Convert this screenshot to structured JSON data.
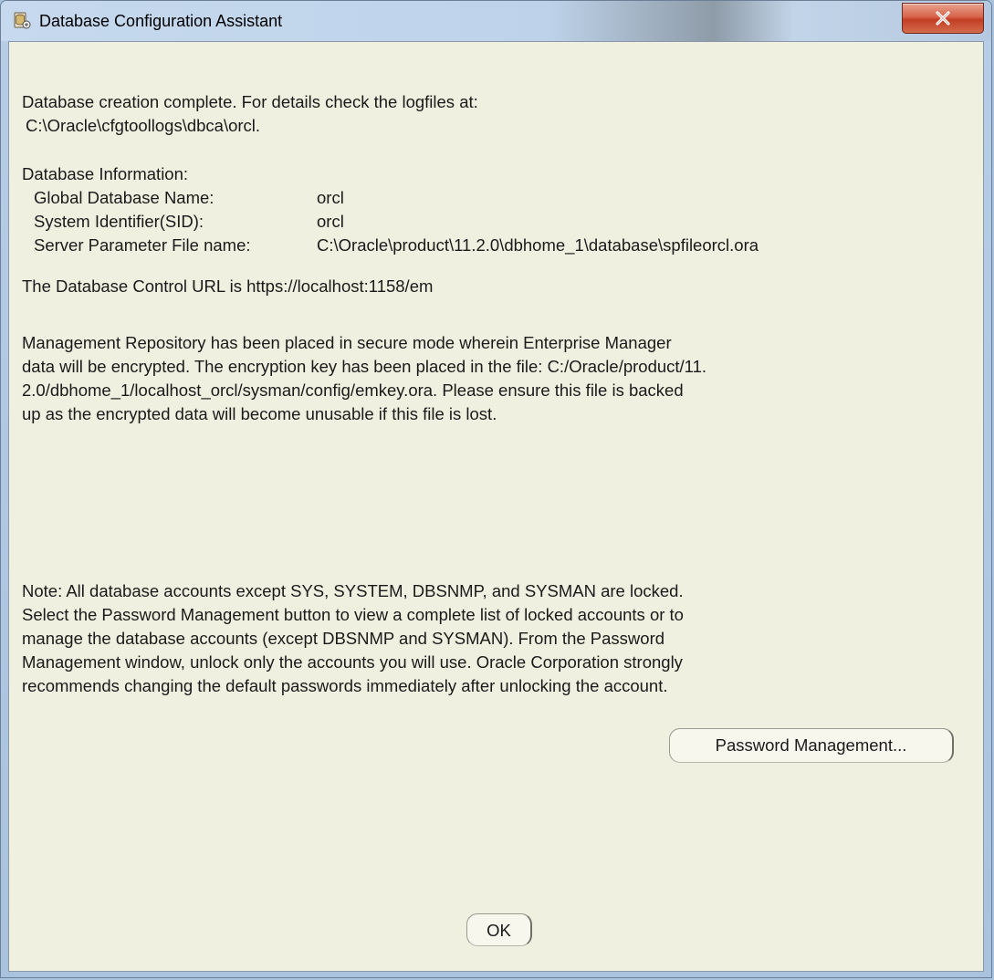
{
  "window": {
    "title": "Database Configuration Assistant"
  },
  "message": {
    "line1": "Database creation complete. For details check the logfiles at:",
    "line2": "C:\\Oracle\\cfgtoollogs\\dbca\\orcl.",
    "info_heading": "Database Information:",
    "info_rows": [
      {
        "label": "Global Database Name:",
        "value": "orcl"
      },
      {
        "label": "System Identifier(SID):",
        "value": "orcl"
      },
      {
        "label": "Server Parameter File name:",
        "value": "C:\\Oracle\\product\\11.2.0\\dbhome_1\\database\\spfileorcl.ora"
      }
    ],
    "control_url": "The Database Control URL is https://localhost:1158/em",
    "repo_lines": [
      "Management Repository has been placed in secure mode wherein Enterprise Manager",
      "data will be encrypted.  The encryption key has been placed in the file: C:/Oracle/product/11.",
      "2.0/dbhome_1/localhost_orcl/sysman/config/emkey.ora.   Please ensure this file is backed",
      "up as the encrypted data will become unusable if this file is lost."
    ],
    "note_lines": [
      "Note: All database accounts except SYS, SYSTEM, DBSNMP, and SYSMAN are locked.",
      "Select the Password Management button to view a complete list of locked accounts or to",
      "manage the database accounts (except DBSNMP and SYSMAN). From the Password",
      "Management window, unlock only the accounts you will use. Oracle Corporation strongly",
      "recommends changing the default passwords immediately after unlocking the account."
    ]
  },
  "buttons": {
    "password_management": "Password Management...",
    "ok": "OK"
  },
  "icons": {
    "app": "database-assistant-icon",
    "close": "close-icon"
  },
  "colors": {
    "client_background": "#f0f0e0",
    "close_button": "#c23d24"
  }
}
